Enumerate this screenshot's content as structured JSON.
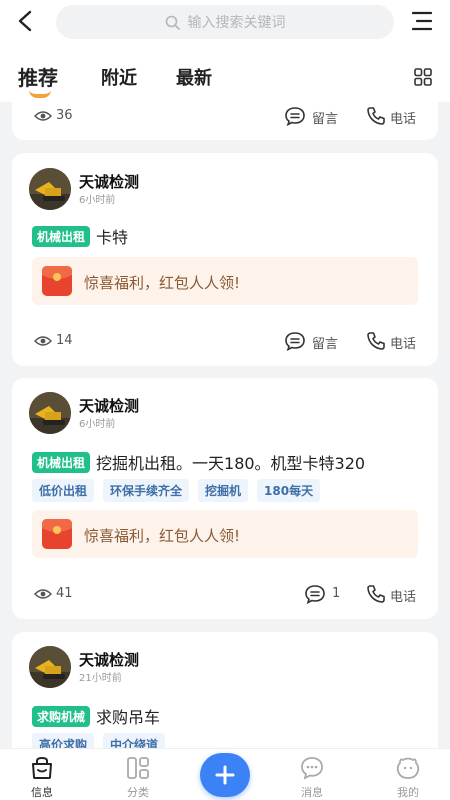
{
  "search": {
    "placeholder": "输入搜索关键词"
  },
  "tabs": [
    {
      "label": "推荐",
      "active": true
    },
    {
      "label": "附近",
      "active": false
    },
    {
      "label": "最新",
      "active": false
    }
  ],
  "partial_card": {
    "views": "36",
    "comment_label": "留言",
    "phone_label": "电话"
  },
  "posts": [
    {
      "user": "天诚检测",
      "time": "6小时前",
      "tag": "机械出租",
      "title": "卡特",
      "chips": [],
      "promo": "惊喜福利，红包人人领!",
      "views": "14",
      "comment_label": "留言",
      "phone_label": "电话"
    },
    {
      "user": "天诚检测",
      "time": "6小时前",
      "tag": "机械出租",
      "title": "挖掘机出租。一天180。机型卡特320",
      "chips": [
        "低价出租",
        "环保手续齐全",
        "挖掘机",
        "180每天"
      ],
      "promo": "惊喜福利，红包人人领!",
      "views": "41",
      "comment_label": "1",
      "phone_label": "电话"
    },
    {
      "user": "天诚检测",
      "time": "21小时前",
      "tag": "求购机械",
      "title": "求购吊车",
      "chips": [
        "高价求购",
        "中介绕道"
      ]
    }
  ],
  "bottom_nav": [
    {
      "label": "信息",
      "icon": "info-bag-icon",
      "active": true
    },
    {
      "label": "分类",
      "icon": "category-icon",
      "active": false
    },
    {
      "label": "消息",
      "icon": "message-icon",
      "active": false
    },
    {
      "label": "我的",
      "icon": "profile-icon",
      "active": false
    }
  ],
  "fab_icon": "plus-icon",
  "colors": {
    "accent": "#3b82f6",
    "tag_green": "#21c08b",
    "tab_underline": "#f2a23a",
    "promo_bg": "#fdf3ea"
  }
}
